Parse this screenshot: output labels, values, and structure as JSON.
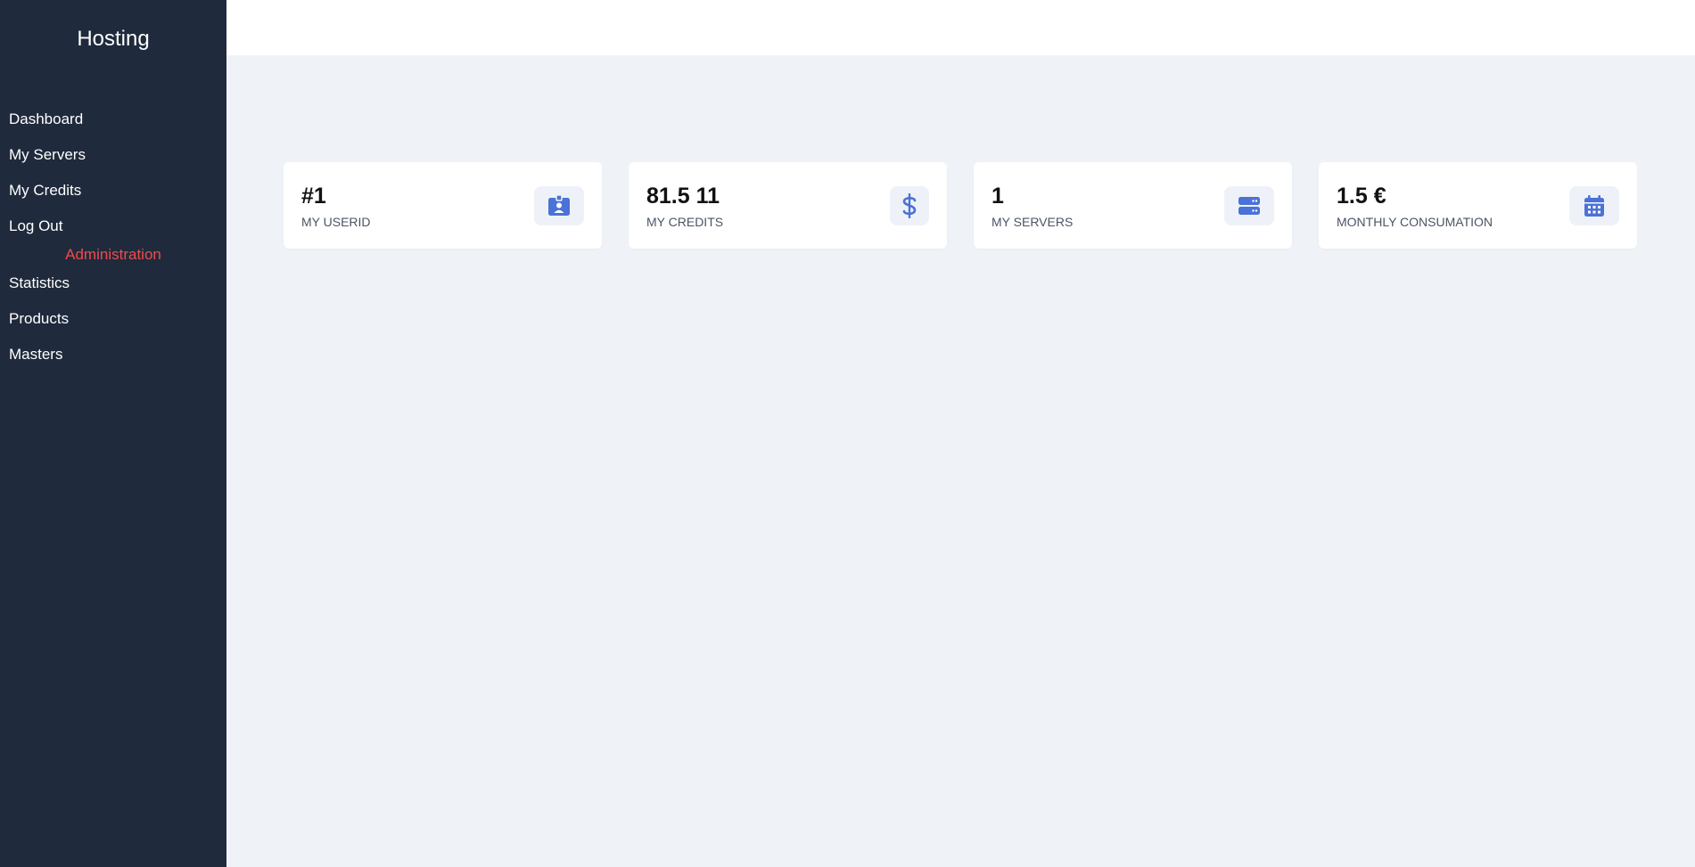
{
  "app": {
    "title": "Hosting"
  },
  "sidebar": {
    "items": [
      {
        "label": "Dashboard"
      },
      {
        "label": "My Servers"
      },
      {
        "label": "My Credits"
      },
      {
        "label": "Log Out"
      }
    ],
    "section": "Administration",
    "admin_items": [
      {
        "label": "Statistics"
      },
      {
        "label": "Products"
      },
      {
        "label": "Masters"
      }
    ]
  },
  "cards": [
    {
      "value": "#1",
      "label": "MY USERID",
      "icon": "id-card-icon"
    },
    {
      "value": "81.5 11",
      "label": "MY CREDITS",
      "icon": "dollar-icon"
    },
    {
      "value": "1",
      "label": "MY SERVERS",
      "icon": "server-icon"
    },
    {
      "value": "1.5 €",
      "label": "MONTHLY CONSUMATION",
      "icon": "calendar-icon"
    }
  ],
  "colors": {
    "sidebar_bg": "#1f2a3c",
    "accent": "#4b72d6",
    "section_label": "#f04a4a",
    "page_bg": "#eff3f8"
  }
}
